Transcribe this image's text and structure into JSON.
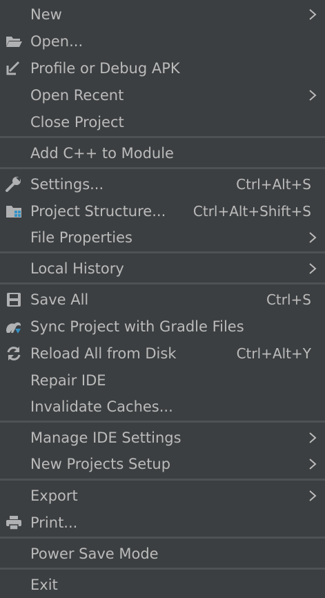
{
  "menu": {
    "new": {
      "label": "New"
    },
    "open": {
      "label": "Open..."
    },
    "profile_debug_apk": {
      "label": "Profile or Debug APK"
    },
    "open_recent": {
      "label": "Open Recent"
    },
    "close_project": {
      "label": "Close Project"
    },
    "add_cpp_to_module": {
      "label": "Add C++ to Module"
    },
    "settings": {
      "label": "Settings...",
      "shortcut": "Ctrl+Alt+S"
    },
    "project_structure": {
      "label": "Project Structure...",
      "shortcut": "Ctrl+Alt+Shift+S"
    },
    "file_properties": {
      "label": "File Properties"
    },
    "local_history": {
      "label": "Local History"
    },
    "save_all": {
      "label": "Save All",
      "shortcut": "Ctrl+S"
    },
    "sync_gradle": {
      "label": "Sync Project with Gradle Files"
    },
    "reload_from_disk": {
      "label": "Reload All from Disk",
      "shortcut": "Ctrl+Alt+Y"
    },
    "repair_ide": {
      "label": "Repair IDE"
    },
    "invalidate_caches": {
      "label": "Invalidate Caches..."
    },
    "manage_ide_settings": {
      "label": "Manage IDE Settings"
    },
    "new_projects_setup": {
      "label": "New Projects Setup"
    },
    "export": {
      "label": "Export"
    },
    "print": {
      "label": "Print..."
    },
    "power_save_mode": {
      "label": "Power Save Mode"
    },
    "exit": {
      "label": "Exit"
    }
  },
  "colors": {
    "background": "#3c3f41",
    "text": "#bbbbbb",
    "separator": "#4f5254",
    "icon_gray": "#afb1b3",
    "icon_blue": "#3592c4"
  },
  "icons": {
    "open": "folder-open-icon",
    "profile_debug_apk": "arrow-down-left-icon",
    "settings": "wrench-icon",
    "project_structure": "project-structure-icon",
    "save_all": "floppy-disk-icon",
    "sync_gradle": "gradle-sync-icon",
    "reload_from_disk": "refresh-icon",
    "print": "printer-icon",
    "submenu": "chevron-right-icon"
  }
}
